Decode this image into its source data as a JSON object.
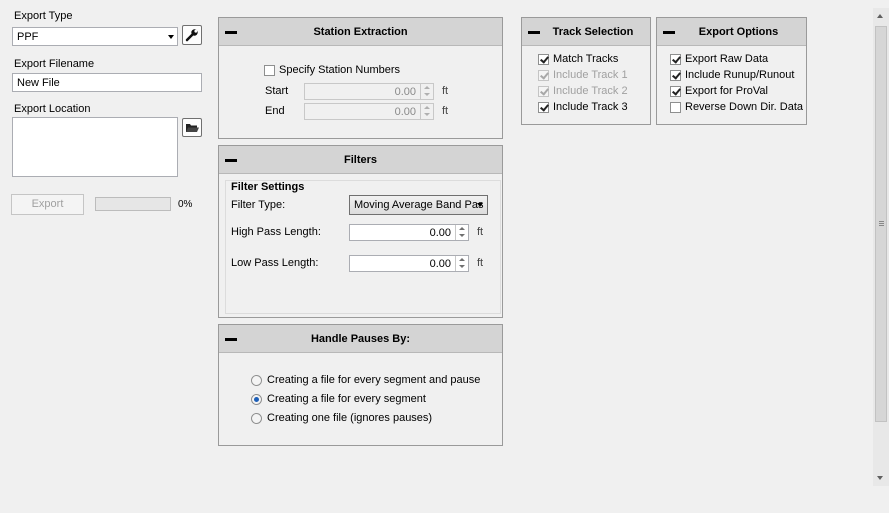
{
  "export_type": {
    "label": "Export Type",
    "value": "PPF"
  },
  "export_filename": {
    "label": "Export Filename",
    "value": "New File"
  },
  "export_location": {
    "label": "Export Location",
    "value": ""
  },
  "export_button": {
    "label": "Export"
  },
  "progress": {
    "value": 0,
    "text": "0%"
  },
  "station": {
    "title": "Station Extraction",
    "specify_label": "Specify Station Numbers",
    "specify_checked": false,
    "start_label": "Start",
    "start_value": "0.00",
    "end_label": "End",
    "end_value": "0.00",
    "unit": "ft"
  },
  "filters": {
    "title": "Filters",
    "group_label": "Filter Settings",
    "type_label": "Filter Type:",
    "type_value": "Moving Average Band Pas",
    "high_label": "High Pass Length:",
    "high_value": "0.00",
    "low_label": "Low Pass Length:",
    "low_value": "0.00",
    "unit": "ft"
  },
  "pauses": {
    "title": "Handle Pauses By:",
    "options": [
      {
        "label": "Creating a file for every segment and pause",
        "selected": false
      },
      {
        "label": "Creating a file for every segment",
        "selected": true
      },
      {
        "label": "Creating one file (ignores pauses)",
        "selected": false
      }
    ]
  },
  "tracks": {
    "title": "Track Selection",
    "items": [
      {
        "label": "Match Tracks",
        "checked": true,
        "enabled": true
      },
      {
        "label": "Include Track 1",
        "checked": true,
        "enabled": false
      },
      {
        "label": "Include Track 2",
        "checked": true,
        "enabled": false
      },
      {
        "label": "Include Track 3",
        "checked": true,
        "enabled": true
      }
    ]
  },
  "export_options": {
    "title": "Export Options",
    "items": [
      {
        "label": "Export Raw Data",
        "checked": true
      },
      {
        "label": "Include Runup/Runout",
        "checked": true
      },
      {
        "label": "Export for ProVal",
        "checked": true
      },
      {
        "label": "Reverse Down Dir. Data",
        "checked": false
      }
    ]
  }
}
